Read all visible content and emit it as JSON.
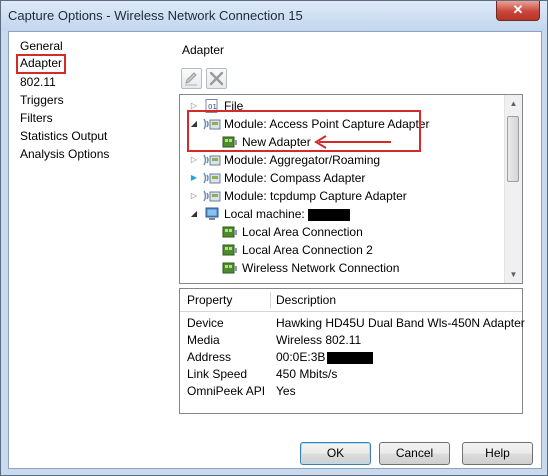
{
  "window": {
    "title": "Capture Options - Wireless Network Connection 15",
    "close_glyph": "✕"
  },
  "nav": {
    "items": [
      "General",
      "Adapter",
      "802.11",
      "Triggers",
      "Filters",
      "Statistics Output",
      "Analysis Options"
    ],
    "selected": "Adapter"
  },
  "section": {
    "title": "Adapter"
  },
  "toolbar": {
    "edit_icon": "pencil-icon",
    "delete_icon": "delete-x-icon"
  },
  "tree": {
    "rows": [
      {
        "label": "File",
        "icon": "file-icon",
        "expander": "collapsed"
      },
      {
        "label": "Module: Access Point Capture Adapter",
        "icon": "module-icon",
        "expander": "expanded"
      },
      {
        "label": "New Adapter",
        "icon": "network-adapter-icon",
        "expander": "none"
      },
      {
        "label": "Module: Aggregator/Roaming",
        "icon": "module-icon",
        "expander": "collapsed"
      },
      {
        "label": "Module: Compass Adapter",
        "icon": "module-icon",
        "expander": "collapsed-highlight"
      },
      {
        "label": "Module: tcpdump Capture Adapter",
        "icon": "module-icon",
        "expander": "collapsed"
      },
      {
        "label": "Local machine:",
        "icon": "computer-icon",
        "expander": "expanded"
      },
      {
        "label": "Local Area Connection",
        "icon": "network-adapter-icon",
        "expander": "none"
      },
      {
        "label": "Local Area Connection 2",
        "icon": "network-adapter-icon",
        "expander": "none"
      },
      {
        "label": "Wireless Network Connection",
        "icon": "network-adapter-icon",
        "expander": "none"
      }
    ]
  },
  "properties": {
    "headers": [
      "Property",
      "Description"
    ],
    "rows": [
      {
        "property": "Device",
        "description": "Hawking HD45U Dual Band Wls-450N Adapter"
      },
      {
        "property": "Media",
        "description": "Wireless 802.11"
      },
      {
        "property": "Address",
        "description": "00:0E:3B"
      },
      {
        "property": "Link Speed",
        "description": "450 Mbits/s"
      },
      {
        "property": "OmniPeek API",
        "description": "Yes"
      }
    ]
  },
  "buttons": {
    "ok": "OK",
    "cancel": "Cancel",
    "help": "Help"
  },
  "colors": {
    "annotation": "#d42a2a",
    "title_bar": "#c3d6ee",
    "selection_arrow": "#d42a2a"
  }
}
